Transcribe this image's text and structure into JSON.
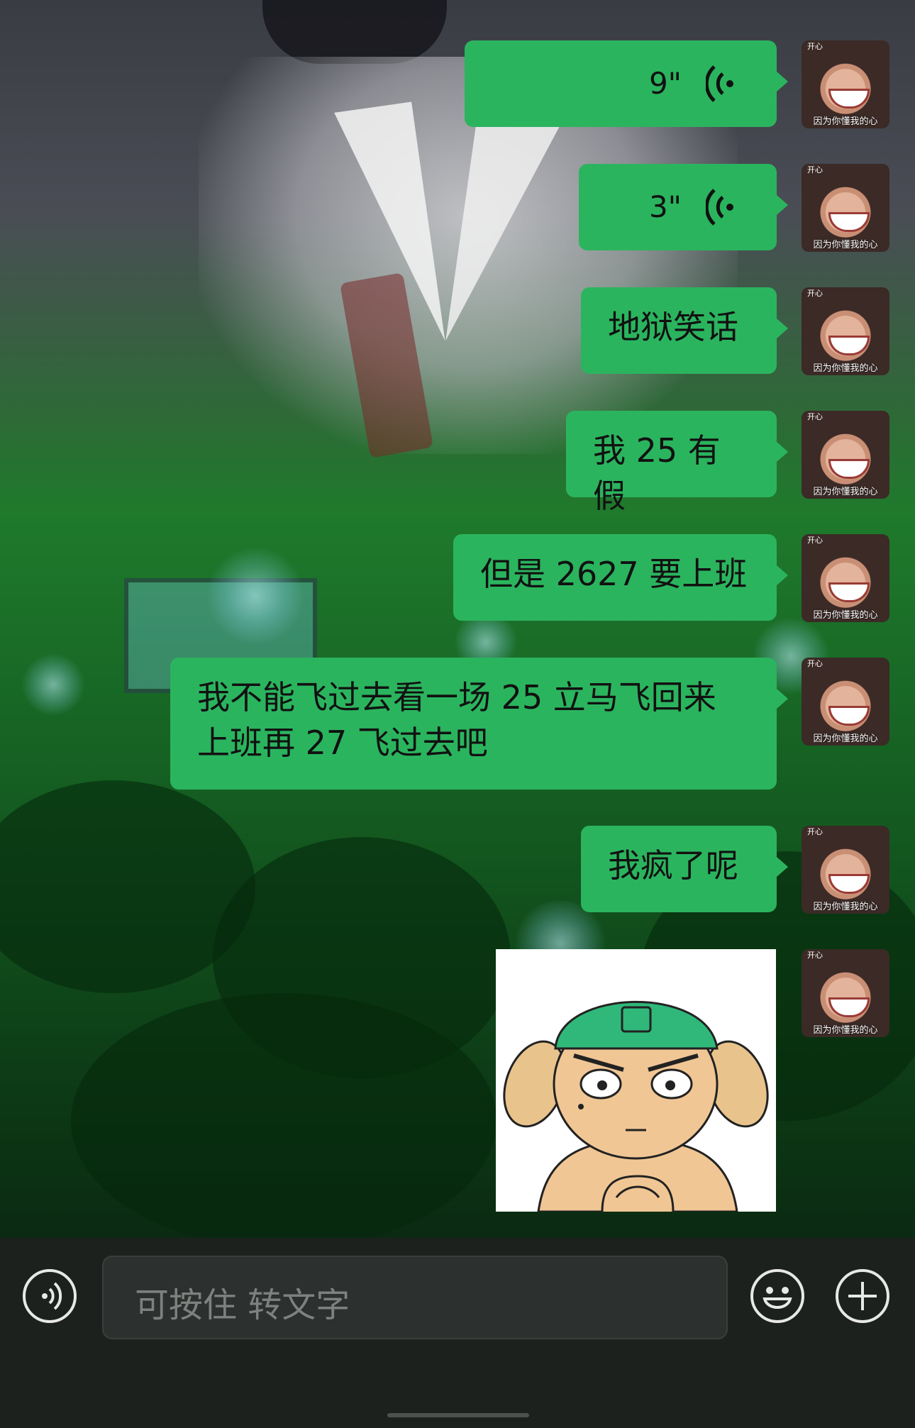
{
  "messages": [
    {
      "type": "voice",
      "duration": "9\""
    },
    {
      "type": "voice",
      "duration": "3\""
    },
    {
      "type": "text",
      "text": "地狱笑话"
    },
    {
      "type": "text",
      "text": "我 25 有假"
    },
    {
      "type": "text",
      "text": "但是 2627 要上班"
    },
    {
      "type": "text",
      "text": "我不能飞过去看一场 25 立马飞回来上班再 27 飞过去吧"
    },
    {
      "type": "text",
      "text": "我疯了呢"
    },
    {
      "type": "sticker"
    }
  ],
  "avatar": {
    "caption": "因为你懂我的心",
    "top_label": "开心"
  },
  "input": {
    "placeholder": "可按住 转文字"
  },
  "icons": {
    "voice": "voice-input-icon",
    "emoji": "emoji-icon",
    "plus": "plus-icon"
  },
  "colors": {
    "bubble": "#2bb45e",
    "bar": "#1c211e"
  }
}
